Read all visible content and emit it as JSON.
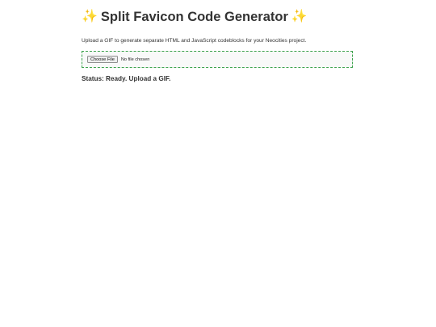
{
  "header": {
    "sparkle_left": "✨",
    "title": "Split Favicon Code Generator",
    "sparkle_right": "✨"
  },
  "description": "Upload a GIF to generate separate HTML and JavaScript codeblocks for your Neocities project.",
  "upload": {
    "button_label": "Choose File",
    "file_status": "No file chosen",
    "border_color": "#3aa14a"
  },
  "status": "Status: Ready. Upload a GIF.",
  "colors": {
    "sparkle": "#f2c200",
    "text": "#333333"
  }
}
